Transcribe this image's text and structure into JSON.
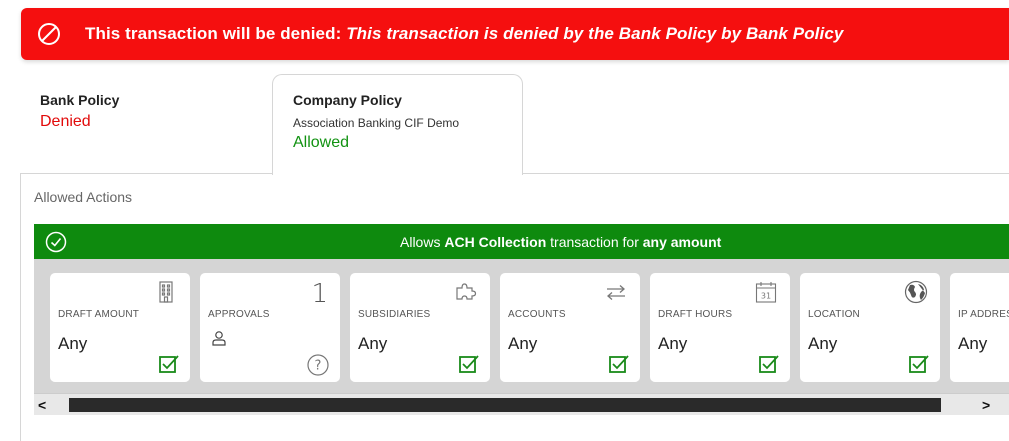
{
  "alert": {
    "prefix": "This transaction will be denied:",
    "reason": "This transaction is denied by the Bank Policy by Bank Policy",
    "color": "#f50f0f"
  },
  "tabs": {
    "bank": {
      "title": "Bank Policy",
      "status": "Denied"
    },
    "company": {
      "title": "Company Policy",
      "subtitle": "Association Banking CIF Demo",
      "status": "Allowed"
    }
  },
  "allowed_actions": {
    "label": "Allowed Actions",
    "banner": {
      "pre": "Allows ",
      "type": "ACH Collection",
      "mid": " transaction for ",
      "amount": "any amount",
      "color": "#0e8a0e"
    }
  },
  "cards": [
    {
      "label": "DRAFT AMOUNT",
      "value": "Any",
      "icon": "building-icon"
    },
    {
      "label": "APPROVALS",
      "value": "1",
      "icon": "user-icon"
    },
    {
      "label": "SUBSIDIARIES",
      "value": "Any",
      "icon": "puzzle-icon"
    },
    {
      "label": "ACCOUNTS",
      "value": "Any",
      "icon": "transfer-arrows-icon"
    },
    {
      "label": "DRAFT HOURS",
      "value": "Any",
      "icon": "calendar-icon",
      "icon_text": "31"
    },
    {
      "label": "LOCATION",
      "value": "Any",
      "icon": "globe-icon"
    },
    {
      "label": "IP ADDRESS",
      "value": "Any",
      "icon": "ip-icon"
    }
  ],
  "scrollbar": {
    "left_arrow": "<",
    "right_arrow": ">"
  }
}
